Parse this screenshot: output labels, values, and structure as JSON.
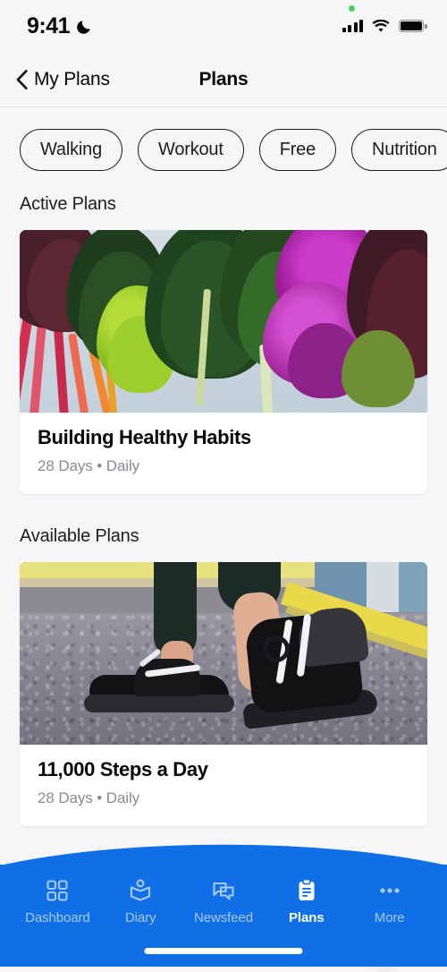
{
  "status_bar": {
    "time": "9:41",
    "dnd_icon": "moon-icon",
    "recording_dot_color": "#44d362",
    "signal_icon": "cellular-signal-icon",
    "wifi_icon": "wifi-icon",
    "battery_icon": "battery-full-icon"
  },
  "nav": {
    "back_label": "My Plans",
    "back_icon": "chevron-left-icon",
    "title": "Plans"
  },
  "filters": {
    "chips": [
      {
        "label": "Walking"
      },
      {
        "label": "Workout"
      },
      {
        "label": "Free"
      },
      {
        "label": "Nutrition"
      }
    ]
  },
  "sections": [
    {
      "title": "Active Plans",
      "cards": [
        {
          "title": "Building Healthy Habits",
          "meta": "28 Days • Daily",
          "photo": "leafy-greens-vegetables-photo"
        }
      ]
    },
    {
      "title": "Available Plans",
      "cards": [
        {
          "title": "11,000 Steps a Day",
          "meta": "28 Days • Daily",
          "photo": "black-sneakers-walking-photo"
        }
      ]
    }
  ],
  "tabbar": {
    "background_color": "#0f6fe6",
    "active_color": "#ffffff",
    "inactive_color": "#a8c9f4",
    "tabs": [
      {
        "label": "Dashboard",
        "icon": "grid-icon",
        "active": false
      },
      {
        "label": "Diary",
        "icon": "book-icon",
        "active": false
      },
      {
        "label": "Newsfeed",
        "icon": "chat-bubbles-icon",
        "active": false
      },
      {
        "label": "Plans",
        "icon": "clipboard-icon",
        "active": true
      },
      {
        "label": "More",
        "icon": "ellipsis-icon",
        "active": false
      }
    ]
  }
}
